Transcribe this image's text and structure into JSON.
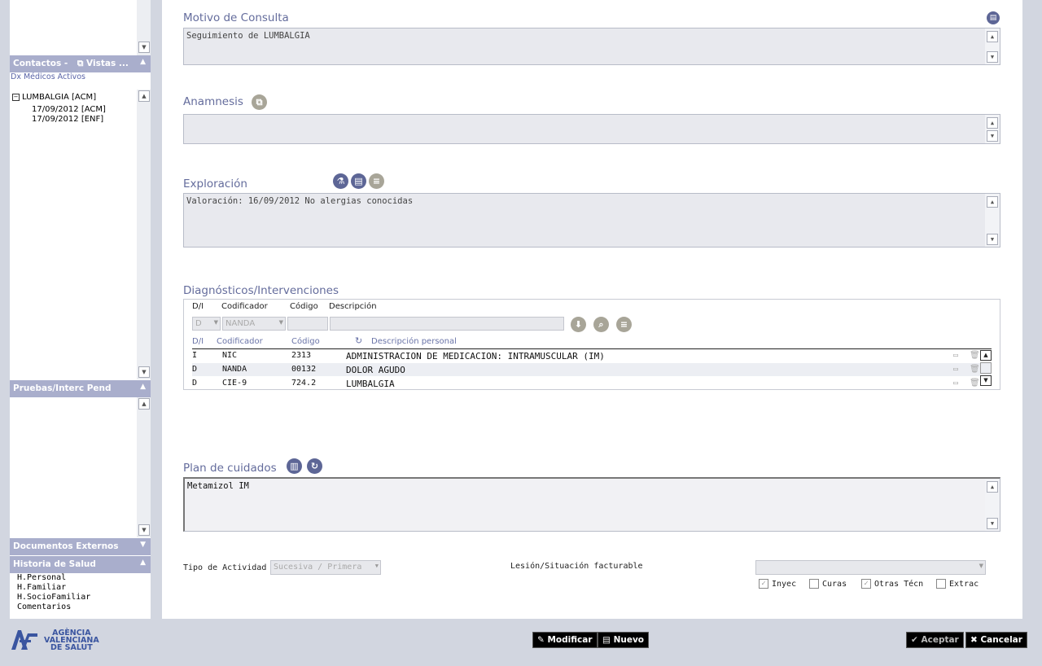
{
  "sidebar": {
    "contactos_header": "Contactos -",
    "vistas_label": "Vistas ...",
    "sub_label": "Dx Médicos Activos",
    "tree_root": "LUMBALGIA [ACM]",
    "tree_children": [
      "17/09/2012 [ACM]",
      "17/09/2012 [ENF]"
    ],
    "pruebas_header": "Pruebas/Interc Pend",
    "documentos_header": "Documentos Externos",
    "historia_header": "Historia de Salud",
    "historia_items": [
      "H.Personal",
      "H.Familiar",
      "H.SocioFamiliar",
      "Comentarios"
    ]
  },
  "motivo": {
    "title": "Motivo de Consulta",
    "text": "Seguimiento de LUMBALGIA"
  },
  "anamnesis": {
    "title": "Anamnesis",
    "text": ""
  },
  "exploracion": {
    "title": "Exploración",
    "text": "Valoración: 16/09/2012 No alergias conocidas"
  },
  "diagnosticos": {
    "title": "Diagnósticos/Intervenciones",
    "header": {
      "di": "D/I",
      "codificador": "Codificador",
      "codigo": "Código",
      "descripcion": "Descripción"
    },
    "input": {
      "di": "D",
      "codificador": "NANDA"
    },
    "list_header": {
      "di": "D/I",
      "codificador": "Codificador",
      "codigo": "Código",
      "descripcion": "Descripción personal"
    },
    "rows": [
      {
        "di": "I",
        "codificador": "NIC",
        "codigo": "2313",
        "descripcion": "ADMINISTRACION DE MEDICACION: INTRAMUSCULAR (IM)"
      },
      {
        "di": "D",
        "codificador": "NANDA",
        "codigo": "00132",
        "descripcion": "DOLOR AGUDO"
      },
      {
        "di": "D",
        "codificador": "CIE-9",
        "codigo": "724.2",
        "descripcion": "LUMBALGIA"
      }
    ]
  },
  "plan": {
    "title": "Plan de cuidados",
    "text": "Metamizol IM"
  },
  "actividad": {
    "label": "Tipo de Actividad",
    "value": "Sucesiva / Primera"
  },
  "lesion": {
    "label": "Lesión/Situación facturable",
    "value": ""
  },
  "checks": [
    {
      "label": "Inyec",
      "checked": true
    },
    {
      "label": "Curas",
      "checked": false
    },
    {
      "label": "Otras Técn",
      "checked": true
    },
    {
      "label": "Extrac",
      "checked": false
    }
  ],
  "footer": {
    "modificar": "Modificar",
    "nuevo": "Nuevo",
    "aceptar": "Aceptar",
    "cancelar": "Cancelar",
    "logo_lines": [
      "AGÈNCIA",
      "VALENCIANA",
      "DE SALUT"
    ]
  },
  "colors": {
    "accent": "#646c9c",
    "header": "#a9aecc",
    "background": "#d2d6e0"
  }
}
